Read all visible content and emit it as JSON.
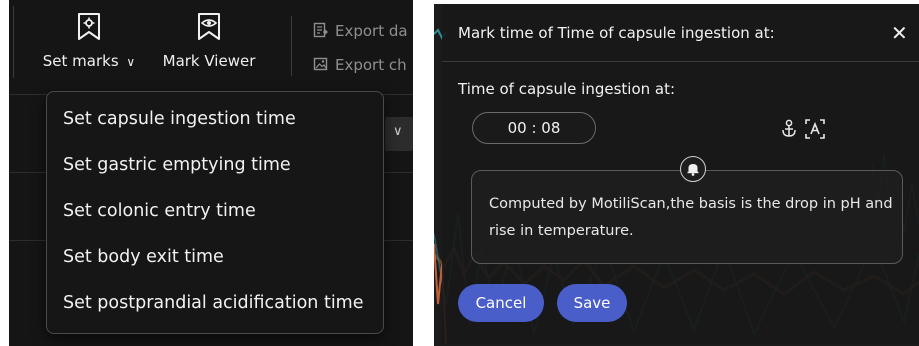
{
  "toolbar": {
    "set_marks": {
      "label": "Set marks",
      "caret": "∨",
      "icon": "bookmark-gear-icon"
    },
    "mark_viewer": {
      "label": "Mark Viewer",
      "icon": "bookmark-eye-icon"
    },
    "export_data": {
      "label": "Export da",
      "icon": "export-doc-icon"
    },
    "export_chart": {
      "label": "Export ch",
      "icon": "export-image-icon"
    }
  },
  "dropdown_chevron": "∨",
  "set_marks_menu": {
    "items": [
      "Set capsule ingestion time",
      "Set gastric emptying time",
      "Set colonic entry time",
      "Set body exit time",
      "Set postprandial acidification time"
    ]
  },
  "dialog": {
    "title": "Mark time of Time of capsule ingestion at:",
    "close": "✕",
    "field_label": "Time of capsule ingestion at:",
    "time_value": "00 : 08",
    "icons": [
      "anchor-icon",
      "text-select-icon",
      "bell-icon"
    ],
    "note": "Computed by MotiliScan,the basis is the drop in pH and rise in temperature.",
    "cancel_label": "Cancel",
    "save_label": "Save"
  },
  "colors": {
    "accent_button": "#4a5ec9",
    "panel_bg": "#151515",
    "dialog_bg": "#1f1f1f"
  }
}
